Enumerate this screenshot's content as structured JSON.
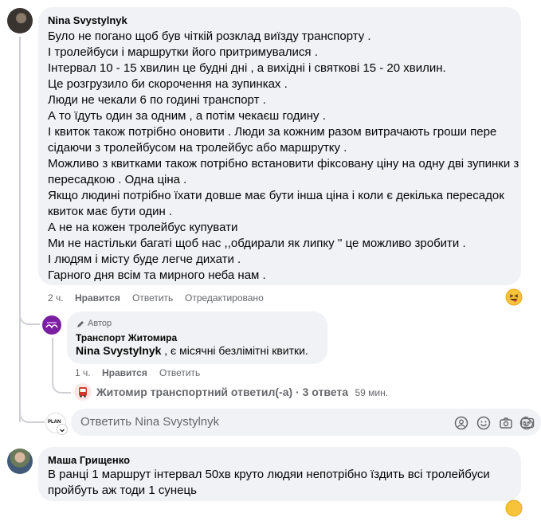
{
  "comment1": {
    "author": "Nina Svystylnyk",
    "lines": [
      "Було не погано щоб був чіткій розклад виїзду транспорту .",
      "І тролейбуси і маршрутки його притримувалися .",
      "Інтервал 10 - 15 хвилин це будні дні , а вихідні і святкові 15 - 20 хвилин.",
      "Це розгрузило би скорочення на зупинках .",
      "Люди не чекали 6 по годині транспорт .",
      "А то їдуть один за одним , а потім чекаєш годину .",
      "І квиток також потрібно оновити . Люди за кожним разом витрачають гроши пере",
      "сідаючи з тролейбусом на тролейбус або маршрутку .",
      "Можливо з квитками також потрібно встановити фіксовану ціну на одну дві зупинки з",
      "пересадкою . Одна ціна .",
      "Якщо людині потрібно їхати довше має бути інша ціна і коли є декілька пересадок",
      "квиток має бути один .",
      "А не на кожен тролейбус купувати",
      "Ми не настільки багаті щоб нас ,,обдирали як липку '' це можливо зробити .",
      "І людям і місту буде легче дихати .",
      "Гарного дня всім та мирного неба нам ."
    ],
    "time": "2 ч.",
    "like": "Нравится",
    "reply": "Ответить",
    "edited": "Отредактировано"
  },
  "reply1": {
    "badge": "Автор",
    "author": "Транспорт Житомира",
    "mention": "Nina Svystylnyk",
    "text": ", є місячні безлімітні квитки.",
    "time": "1 ч.",
    "like": "Нравится",
    "reply": "Ответить"
  },
  "more_replies": {
    "text": "Житомир транспортний ответил(-а) · 3 ответа",
    "time": "59 мин."
  },
  "reply_box": {
    "placeholder": "Ответить Nina Svystylnyk",
    "avatar_text": "PLAN"
  },
  "comment2": {
    "author": "Маша Грищенко",
    "lines": [
      "В ранці 1 маршрут інтервал 50хв круто людяи непотрібно їздить всі тролейбуси",
      "пройбуть аж тоди 1 сунець"
    ]
  },
  "colors": {
    "bubble": "#f0f2f5",
    "meta": "#65676b",
    "thread": "#ced0d4",
    "text": "#050505"
  }
}
